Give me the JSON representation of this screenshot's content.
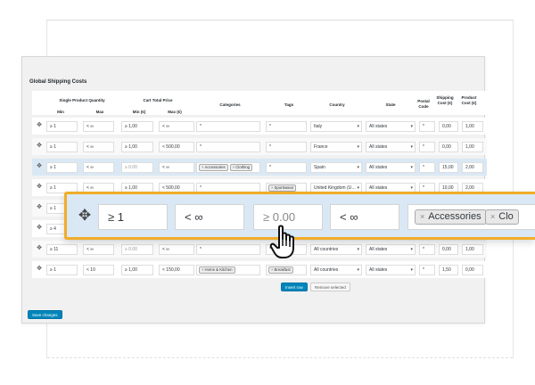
{
  "panel": {
    "title": "Global Shipping Costs",
    "save_label": "Save changes",
    "insert_label": "Insert row",
    "remove_label": "Remove selected"
  },
  "headers": {
    "single_qty": "Single Product Quantity",
    "cart_total": "Cart Total Price",
    "min": "Min",
    "max": "Max",
    "min_cur": "Min (€)",
    "max_cur": "Max (€)",
    "categories": "Categories",
    "tags": "Tags",
    "country": "Country",
    "state": "State",
    "postal": "Postal Code",
    "shipping": "Shipping Cost (€)",
    "product": "Product Cost (€)"
  },
  "rows": [
    {
      "qmin": "≥ 1",
      "qmax": "< ∞",
      "cmin": "≥ 1,00",
      "cmax": "< ∞",
      "cats": "*",
      "tags": "*",
      "country": "Italy",
      "state": "All states",
      "postal": "*",
      "ship": "0,00",
      "prod": "1,00"
    },
    {
      "qmin": "≥ 1",
      "qmax": "< ∞",
      "cmin": "≥ 1,00",
      "cmax": "< 500,00",
      "cats": "*",
      "tags": "*",
      "country": "France",
      "state": "All states",
      "postal": "*",
      "ship": "0,00",
      "prod": "1,00"
    },
    {
      "qmin": "≥ 1",
      "qmax": "< ∞",
      "cmin": "≥ 0.00",
      "cmax": "< ∞",
      "cat_tags": [
        "Accessories",
        "Clothing"
      ],
      "tags": "*",
      "country": "Spain",
      "state": "All states",
      "postal": "*",
      "ship": "15,00",
      "prod": "2,00"
    },
    {
      "qmin": "≥ 1",
      "qmax": "< ∞",
      "cmin": "≥ 1,00",
      "cmax": "< 500,00",
      "cats": "*",
      "tag_tags": [
        "Sportswear"
      ],
      "country": "United Kingdom (U…",
      "state": "All states",
      "postal": "*",
      "ship": "10,00",
      "prod": "2,00"
    },
    {
      "qmin": "≥ 1",
      "qmax": "",
      "cmin": "",
      "cmax": "",
      "cats": "",
      "tags": "",
      "country": "",
      "state": "",
      "postal": "",
      "ship": "",
      "prod": ""
    },
    {
      "qmin": "≥ 4",
      "qmax": "",
      "cmin": "",
      "cmax": "",
      "cats": "",
      "tags": "",
      "country": "",
      "state": "",
      "postal": "",
      "ship": "",
      "prod": ""
    },
    {
      "qmin": "≥ 11",
      "qmax": "< ∞",
      "cmin": "≥ 0.00",
      "cmax": "< ∞",
      "cats": "*",
      "tags": "*",
      "country": "All countries",
      "state": "All states",
      "postal": "*",
      "ship": "0,00",
      "prod": "1,00"
    },
    {
      "qmin": "≥ 1",
      "qmax": "< 10",
      "cmin": "≥ 1,00",
      "cmax": "< 150,00",
      "cat_tags": [
        "Home & Kitchen"
      ],
      "tag_tags": [
        "Breakfast"
      ],
      "country": "All countries",
      "state": "All states",
      "postal": "*",
      "ship": "1,50",
      "prod": "0,00"
    }
  ],
  "zoom": {
    "qmin": "≥ 1",
    "qmax": "< ∞",
    "cmin": "≥ 0.00",
    "cmax": "< ∞",
    "tag1": "Accessories",
    "tag2": "Clo"
  },
  "colors": {
    "highlight_border": "#f0ad2a",
    "selected_row": "#d9e8f4",
    "primary_button": "#0085ba"
  },
  "icons": {
    "drag": "move-icon",
    "cursor": "hand-pointer-icon"
  }
}
